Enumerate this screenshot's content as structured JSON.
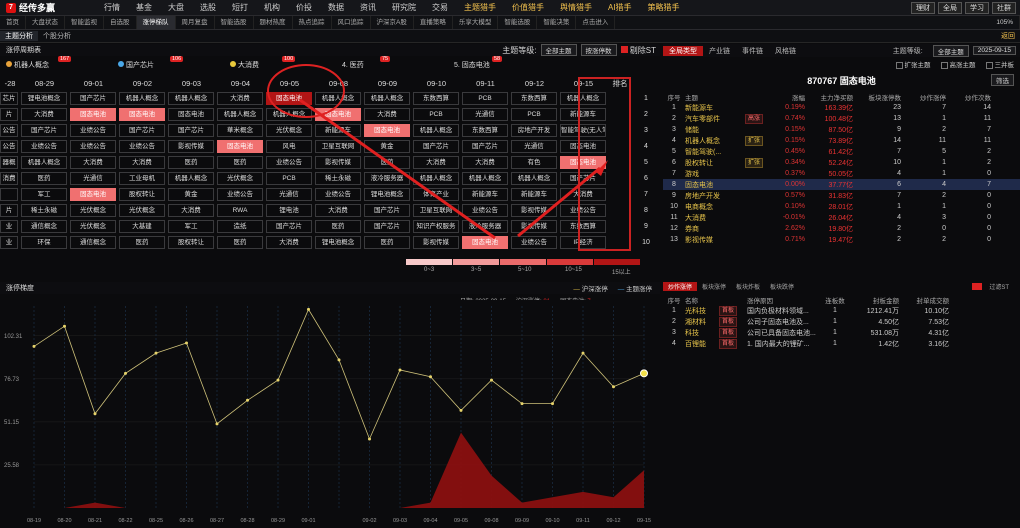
{
  "app": {
    "logo": "经传多赢",
    "menu": [
      "行情",
      "基金",
      "大盘",
      "选股",
      "短打",
      "机构",
      "价投",
      "数据",
      "资讯",
      "研究院",
      "交易",
      "主题猎手",
      "价值猎手",
      "舆情猎手",
      "AI猎手",
      "策略猎手"
    ],
    "right_buttons": [
      "理财",
      "全局",
      "学习",
      "社群"
    ]
  },
  "tabs": [
    "首页",
    "大盘状态",
    "智能监视",
    "自选股",
    "涨停梯队",
    "周月复盘",
    "智能选股",
    "题材热度",
    "热点追踪",
    "风口追踪",
    "沪深京A股",
    "直播策略",
    "乐享大模型",
    "智能选股",
    "智能决策",
    "点击进入"
  ],
  "tabs_zoom": "105%",
  "subtabs": [
    "主题分析",
    "个股分析"
  ],
  "subtabs_return": "返回",
  "left_header": {
    "title": "涨停周期表",
    "level_label": "主题等级:",
    "level_value": "全部主题",
    "sort_value": "按涨停数",
    "exclude_label": "剔除ST"
  },
  "themes": [
    {
      "name": "机器人概念",
      "count": "167",
      "color": "#e8a33b"
    },
    {
      "name": "国产芯片",
      "count": "106",
      "color": "#4aa8e8"
    },
    {
      "name": "大消费",
      "count": "100",
      "color": "#e8c93b"
    },
    {
      "name": "4. 医药",
      "count": "75",
      "color": ""
    },
    {
      "name": "5. 固态电池",
      "count": "58",
      "color": ""
    }
  ],
  "grid": {
    "dates": [
      "-28",
      "08-29",
      "09-01",
      "09-02",
      "09-03",
      "09-04",
      "09-05",
      "09-08",
      "09-09",
      "09-10",
      "09-11",
      "09-12",
      "09-15"
    ],
    "rank_label": "排名",
    "rows": [
      [
        "芯片",
        "锂电池概念",
        "国产芯片",
        "机器人概念",
        "机器人概念",
        "大消费",
        "固态电池",
        "机器人概念",
        "机器人概念",
        "东数西算",
        "PCB",
        "东数西算",
        "机器人概念"
      ],
      [
        "片",
        "大消费",
        "固态电池",
        "固态电池",
        "固态电池",
        "机器人概念",
        "机器人概念",
        "固态电池",
        "大消费",
        "PCB",
        "光通信",
        "PCB",
        "新能源车"
      ],
      [
        "公告",
        "国产芯片",
        "业绩公告",
        "国产芯片",
        "国产芯片",
        "華米概念",
        "光伏概念",
        "新能源车",
        "固态电池",
        "机器人概念",
        "东数西算",
        "房地产开发",
        "智能驾驶(无人驾驶)"
      ],
      [
        "公告",
        "业绩公告",
        "业绩公告",
        "业绩公告",
        "影视传媒",
        "固态电池",
        "风电",
        "卫星互联网",
        "黄金",
        "国产芯片",
        "国产芯片",
        "光通信",
        "固态电池"
      ],
      [
        "器概",
        "机器人概念",
        "大消费",
        "大消费",
        "医药",
        "医药",
        "业绩公告",
        "影视传媒",
        "医药",
        "大消费",
        "大消费",
        "有色",
        "固态电池"
      ],
      [
        "消费",
        "医药",
        "光通信",
        "工业母机",
        "机器人概念",
        "光伏概念",
        "PCB",
        "稀土永磁",
        "液冷服务器",
        "机器人概念",
        "机器人概念",
        "机器人概念",
        "国产芯片"
      ],
      [
        "",
        "军工",
        "固态电池",
        "股权转让",
        "黄金",
        "业绩公告",
        "光通信",
        "业绩公告",
        "锂电池概念",
        "体育产业",
        "新能源车",
        "新能源车",
        "大消费"
      ],
      [
        "片",
        "稀土永磁",
        "光伏概念",
        "光伏概念",
        "大消费",
        "RWA",
        "锂电池",
        "大消费",
        "国产芯片",
        "卫星互联网",
        "业绩公告",
        "影视传媒",
        "业绩公告"
      ],
      [
        "业",
        "通信概念",
        "光伏概念",
        "大基建",
        "军工",
        "造纸",
        "国产芯片",
        "医药",
        "国产芯片",
        "知识产权服务",
        "液冷服务器",
        "影视传媒",
        "东数西算"
      ],
      [
        "业",
        "环保",
        "通信概念",
        "医药",
        "股权转让",
        "医药",
        "大消费",
        "锂电池概念",
        "医药",
        "影视传媒",
        "固态电池",
        "业绩公告",
        "IP经济"
      ]
    ]
  },
  "legend_labels": [
    "0~3",
    "3~5",
    "5~10",
    "10~15",
    "15以上"
  ],
  "chart": {
    "title": "涨停梯度",
    "legend": [
      "沪深涨停",
      "主题涨停"
    ],
    "date_label": "日期:",
    "date_value": "2025-09-15",
    "market_label": "沪深涨停:",
    "market_value": "81",
    "theme_label": "固态电池:",
    "theme_value": "7"
  },
  "chart_data": {
    "type": "line",
    "x": [
      "08-19",
      "08-20",
      "08-21",
      "08-22",
      "08-25",
      "08-26",
      "08-27",
      "08-28",
      "08-29",
      "09-01",
      "09-02",
      "09-03",
      "09-04",
      "09-05",
      "09-08",
      "09-09",
      "09-10",
      "09-11",
      "09-12",
      "09-15"
    ],
    "series": [
      {
        "name": "沪深涨停",
        "values": [
          96,
          108,
          56,
          80,
          92,
          98,
          50,
          64,
          76,
          118,
          88,
          41,
          82,
          78,
          58,
          76,
          62,
          62,
          92,
          72,
          80
        ]
      },
      {
        "name": "主题涨停",
        "values": [
          0,
          0,
          1,
          0,
          0,
          0,
          0,
          0,
          0,
          0,
          0,
          0,
          0,
          1,
          14,
          6,
          1,
          2,
          3,
          2,
          7
        ]
      }
    ],
    "yticks": [
      "102.31",
      "76.73",
      "51.15",
      "25.58"
    ],
    "ylim": [
      0,
      120
    ]
  },
  "right_header": {
    "tabs": [
      "全局类型",
      "产业链",
      "事件链",
      "风格链"
    ],
    "level_label": "主题等级:",
    "level_value": "全部主题",
    "date": "2025-09-15",
    "options": [
      "扩张主题",
      "高涨主题",
      "三并板"
    ],
    "code": "870767 固态电池",
    "filter": "筛选"
  },
  "right_table": {
    "headers": [
      "序号",
      "主题",
      "",
      "涨幅",
      "主力净买额",
      "板块涨停数",
      "炒作涨停",
      "炒作次数"
    ],
    "rows": [
      [
        "1",
        "新能源车",
        "",
        "0.19%",
        "163.39亿",
        "23",
        "7",
        "14"
      ],
      [
        "2",
        "汽车零部件",
        "高涨",
        "0.74%",
        "100.48亿",
        "13",
        "1",
        "11"
      ],
      [
        "3",
        "储能",
        "",
        "0.15%",
        "87.50亿",
        "9",
        "2",
        "7"
      ],
      [
        "4",
        "机器人概念",
        "扩张",
        "0.15%",
        "73.89亿",
        "14",
        "11",
        "11"
      ],
      [
        "5",
        "智能驾驶(...",
        "",
        "0.45%",
        "61.42亿",
        "7",
        "5",
        "2"
      ],
      [
        "6",
        "股权转让",
        "扩张",
        "0.34%",
        "52.24亿",
        "10",
        "1",
        "2"
      ],
      [
        "7",
        "游戏",
        "",
        "0.37%",
        "50.05亿",
        "4",
        "1",
        "0"
      ],
      [
        "8",
        "固态电池",
        "",
        "0.00%",
        "37.77亿",
        "6",
        "4",
        "7"
      ],
      [
        "9",
        "房地产开发",
        "",
        "0.57%",
        "31.83亿",
        "7",
        "2",
        "0"
      ],
      [
        "10",
        "电商概念",
        "",
        "0.10%",
        "28.01亿",
        "1",
        "1",
        "0"
      ],
      [
        "11",
        "大消费",
        "",
        "-0.01%",
        "26.04亿",
        "4",
        "3",
        "0"
      ],
      [
        "12",
        "券商",
        "",
        "2.62%",
        "19.80亿",
        "2",
        "0",
        "0"
      ],
      [
        "13",
        "影视传媒",
        "",
        "0.71%",
        "19.47亿",
        "2",
        "2",
        "0"
      ]
    ]
  },
  "right_bottom": {
    "tabs": [
      "炒作涨停",
      "板块涨停",
      "板块炸板",
      "板块跌停"
    ],
    "filter_label": "过滤ST",
    "headers": [
      "序号",
      "名称",
      "",
      "涨停原因",
      "连板数",
      "封板金额",
      "封单成交额"
    ],
    "rows": [
      [
        "1",
        "光科技",
        "首板",
        "国内负极材料领域...",
        "1",
        "1212.41万",
        "10.10亿"
      ],
      [
        "2",
        "湘材料",
        "首板",
        "公司子固态电池及...",
        "1",
        "4.50亿",
        "7.53亿"
      ],
      [
        "3",
        "科技",
        "首板",
        "公司已具备固态电池...",
        "1",
        "531.08万",
        "4.31亿"
      ],
      [
        "4",
        "百锂能",
        "首板",
        "1. 国内最大的锂矿...",
        "1",
        "1.42亿",
        "3.16亿"
      ]
    ]
  }
}
